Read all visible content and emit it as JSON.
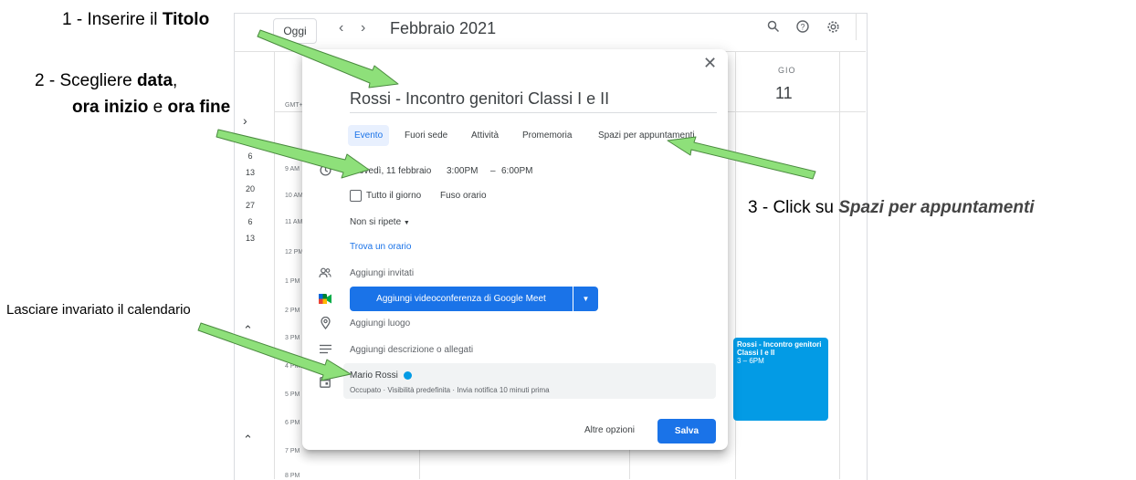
{
  "calendar": {
    "today_label": "Oggi",
    "prev_icon": "‹",
    "next_icon": "›",
    "month_title": "Febbraio 2021",
    "header_icons": [
      "search-icon",
      "help-icon",
      "settings-icon"
    ],
    "timezone_label": "GMT+0",
    "mini_calendar_numbers": [
      "6",
      "13",
      "20",
      "27",
      "6",
      "13"
    ],
    "time_labels": [
      "9 AM",
      "10 AM",
      "11 AM",
      "12 PM",
      "1 PM",
      "2 PM",
      "3 PM",
      "4 PM",
      "5 PM",
      "6 PM",
      "7 PM",
      "8 PM"
    ],
    "day_name": "GIO",
    "day_number": "11",
    "event": {
      "title": "Rossi - Incontro genitori Classi I e II",
      "time": "3 – 6PM",
      "color": "#039be5"
    }
  },
  "dialog": {
    "title_value": "Rossi - Incontro genitori Classi I e II",
    "tabs": [
      "Evento",
      "Fuori sede",
      "Attività",
      "Promemoria",
      "Spazi per appuntamenti"
    ],
    "active_tab": "Evento",
    "date": "Giovedì, 11 febbraio",
    "start_time": "3:00PM",
    "dash": "–",
    "end_time": "6:00PM",
    "all_day_label": "Tutto il giorno",
    "timezone_link": "Fuso orario",
    "repeat": "Non si ripete",
    "find_time": "Trova un orario",
    "add_guests": "Aggiungi invitati",
    "meet_button": "Aggiungi videoconferenza di Google Meet",
    "add_location": "Aggiungi luogo",
    "add_description": "Aggiungi descrizione o allegati",
    "calendar_owner": "Mario Rossi",
    "calendar_details": "Occupato · Visibilità predefinita · Invia notifica 10 minuti prima",
    "more_options": "Altre opzioni",
    "save": "Salva",
    "accent_color": "#1a73e8"
  },
  "annotations": {
    "step1_prefix": "1 - Inserire il ",
    "step1_bold": "Titolo",
    "step2_prefix": "2 - Scegliere ",
    "step2_bold1": "data",
    "step2_comma": ",",
    "step2_bold2": "ora inizio",
    "step2_mid": " e ",
    "step2_bold3": "ora fine",
    "step3_prefix": "3 - Click su ",
    "step3_bold": "Spazi per appuntamenti",
    "calendar_note": "Lasciare invariato il calendario",
    "arrow_color": "#8ee07a"
  }
}
